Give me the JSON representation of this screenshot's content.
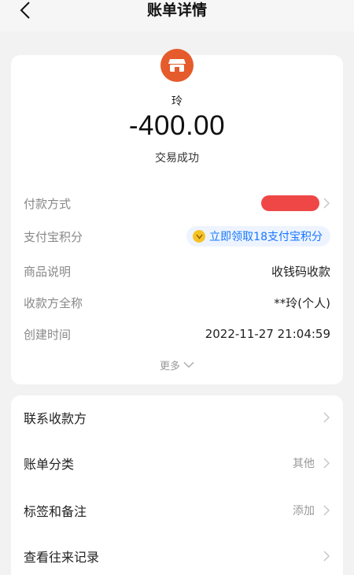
{
  "nav": {
    "title": "账单详情"
  },
  "header": {
    "merchant": "玲",
    "amount": "-400.00",
    "status": "交易成功"
  },
  "details": {
    "payment_method_label": "付款方式",
    "points_label": "支付宝积分",
    "points_action": "立即领取18支付宝积分",
    "item_desc_label": "商品说明",
    "item_desc_value": "收钱码收款",
    "payee_label": "收款方全称",
    "payee_value": "**玲(个人)",
    "created_label": "创建时间",
    "created_value": "2022-11-27 21:04:59",
    "more": "更多"
  },
  "actions": {
    "contact_payee": "联系收款方",
    "bill_category": "账单分类",
    "bill_category_value": "其他",
    "tags_notes": "标签和备注",
    "tags_notes_value": "添加",
    "history": "查看往来记录"
  },
  "colors": {
    "accent": "#1677ff",
    "shop_icon": "#e55b2b",
    "redaction": "#ee3636"
  }
}
